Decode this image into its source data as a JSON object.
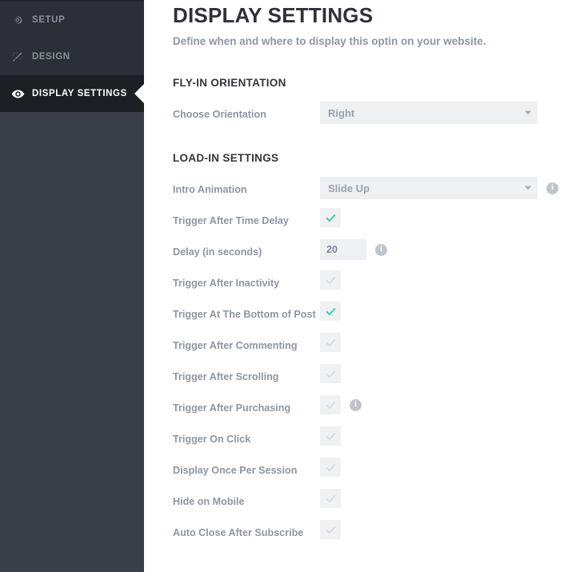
{
  "sidebar": {
    "items": [
      {
        "label": "SETUP",
        "icon": "gear-icon",
        "active": false
      },
      {
        "label": "DESIGN",
        "icon": "magic-wand-icon",
        "active": false
      },
      {
        "label": "DISPLAY SETTINGS",
        "icon": "eye-icon",
        "active": true
      }
    ]
  },
  "header": {
    "title": "DISPLAY SETTINGS",
    "subtitle": "Define when and where to display this optin on your website."
  },
  "sections": [
    {
      "title": "FLY-IN ORIENTATION",
      "fields": [
        {
          "label": "Choose Orientation",
          "type": "select",
          "value": "Right",
          "info": false
        }
      ]
    },
    {
      "title": "LOAD-IN SETTINGS",
      "fields": [
        {
          "label": "Intro Animation",
          "type": "select",
          "value": "Slide Up",
          "info": true
        },
        {
          "label": "Trigger After Time Delay",
          "type": "checkbox",
          "checked": true,
          "info": false
        },
        {
          "label": "Delay (in seconds)",
          "type": "text",
          "value": "20",
          "info": true
        },
        {
          "label": "Trigger After Inactivity",
          "type": "checkbox",
          "checked": false,
          "info": false
        },
        {
          "label": "Trigger At The Bottom of Post",
          "type": "checkbox",
          "checked": true,
          "info": false
        },
        {
          "label": "Trigger After Commenting",
          "type": "checkbox",
          "checked": false,
          "info": false
        },
        {
          "label": "Trigger After Scrolling",
          "type": "checkbox",
          "checked": false,
          "info": false
        },
        {
          "label": "Trigger After Purchasing",
          "type": "checkbox",
          "checked": false,
          "info": true
        },
        {
          "label": "Trigger On Click",
          "type": "checkbox",
          "checked": false,
          "info": false
        },
        {
          "label": "Display Once Per Session",
          "type": "checkbox",
          "checked": false,
          "info": false
        },
        {
          "label": "Hide on Mobile",
          "type": "checkbox",
          "checked": false,
          "info": false
        },
        {
          "label": "Auto Close After Subscribe",
          "type": "checkbox",
          "checked": false,
          "info": false
        }
      ]
    }
  ],
  "colors": {
    "sidebar_bg": "#3b3f4a",
    "nav_item_bg": "#2c2f36",
    "nav_item_active_bg": "#1d1f24",
    "accent_check": "#3ecfb0",
    "label_text": "#8d96a3",
    "field_bg": "#eef0f2"
  },
  "info_tooltip_char": "i"
}
